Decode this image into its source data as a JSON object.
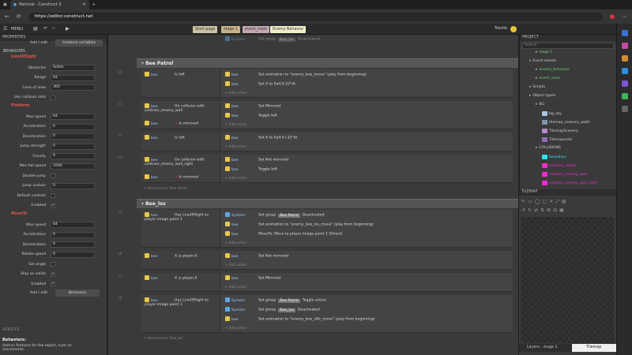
{
  "browser": {
    "tab_title": "Percival - Construct 3",
    "url": "https://editor.construct.net"
  },
  "app": {
    "menu_label": "MENU",
    "layout_tabs": [
      {
        "label": "Start page",
        "color": "#c9c3a4"
      },
      {
        "label": "stage 1",
        "color": "#c9b289"
      },
      {
        "label": "event_main",
        "color": "#c2a7b3"
      },
      {
        "label": "Enemy Behavior",
        "color": "#f2f0c8"
      }
    ],
    "user": "Twistie"
  },
  "properties": {
    "header": "PROPERTIES",
    "add_edit": "Add / edit",
    "instance_variables_btn": "Instance variables",
    "behaviors_header": "BEHAVIORS",
    "los_name": "LineOfSight",
    "los_rows": [
      {
        "label": "Obstacles",
        "value": "Solids"
      },
      {
        "label": "Range",
        "value": "64"
      },
      {
        "label": "Cone of view",
        "value": "360"
      },
      {
        "label": "Use collision cells",
        "value": ""
      }
    ],
    "platform_name": "Platform",
    "platform_rows": [
      {
        "label": "Max speed",
        "value": "64"
      },
      {
        "label": "Acceleration",
        "value": "0"
      },
      {
        "label": "Deceleration",
        "value": "0"
      },
      {
        "label": "Jump strength",
        "value": "0"
      },
      {
        "label": "Gravity",
        "value": "0"
      },
      {
        "label": "Max fall speed",
        "value": "1000"
      },
      {
        "label": "Double-jump",
        "value": ""
      },
      {
        "label": "Jump sustain",
        "value": "0"
      },
      {
        "label": "Default controls",
        "value": ""
      },
      {
        "label": "Enabled",
        "value": "✓"
      }
    ],
    "moveto_name": "MoveTo",
    "moveto_rows": [
      {
        "label": "Max speed",
        "value": "64"
      },
      {
        "label": "Acceleration",
        "value": "0"
      },
      {
        "label": "Deceleration",
        "value": "0"
      },
      {
        "label": "Rotate speed",
        "value": "0"
      },
      {
        "label": "Set angle",
        "value": ""
      },
      {
        "label": "Stop on solids",
        "value": "✓"
      },
      {
        "label": "Enabled",
        "value": "✓"
      }
    ],
    "behaviors_btn": "Behaviors",
    "effects_header": "EFFECTS",
    "help_title": "Behaviors:",
    "help_text": "Add-on features for the object, such as movements."
  },
  "events": {
    "top_rows": [
      {
        "obj": "System",
        "text": "Set group",
        "tag": "Bee_los",
        "text2": "Deactivated"
      }
    ],
    "group1": "Bee Patrol",
    "group1_events": [
      {
        "num": "10",
        "cond_obj": "bee",
        "cond": "Is left",
        "actions": [
          {
            "obj": "bee",
            "text": "Set animation to \"enemy_bee_move\" (play from beginning)"
          },
          {
            "obj": "bee",
            "text": "Set X to Self.X-32*dt"
          }
        ]
      },
      {
        "num": "11",
        "cond_obj": "bee",
        "cond": "On collision with collision_enemy_wall",
        "cond2": "Is mirrored",
        "actions": [
          {
            "obj": "bee",
            "text": "Set Mirrored"
          },
          {
            "obj": "bee",
            "text": "Toggle left"
          }
        ]
      },
      {
        "num": "12",
        "cond_obj": "bee",
        "cond": "Is left",
        "actions": [
          {
            "obj": "bee",
            "text": "Set X to Self.X+32*dt"
          }
        ]
      },
      {
        "num": "13",
        "cond_obj": "bee",
        "cond": "On collision with collision_enemy_wall_right",
        "cond2": "Is mirrored",
        "actions": [
          {
            "obj": "bee",
            "text": "Set Not mirrored"
          },
          {
            "obj": "bee",
            "text": "Toggle left"
          }
        ]
      }
    ],
    "add_action": "Add action",
    "add_event_patrol": "Add event to 'Bee Patrol'",
    "group2": "Bee_los",
    "group2_events": [
      {
        "num": "15",
        "cond_obj": "bee",
        "cond": "Has LineOfSight to player image point 1",
        "actions": [
          {
            "obj": "System",
            "text": "Set group",
            "tag": "Bee Patrol",
            "text2": "Deactivated"
          },
          {
            "obj": "bee",
            "text": "Set animation to \"enemy_bee_los_move\" (play from beginning)"
          },
          {
            "obj": "bee",
            "text": "MoveTo: Move to player image point 1 (Direct)"
          }
        ]
      },
      {
        "num": "16",
        "cond_obj": "bee",
        "cond": "X ≤ player.X",
        "actions": [
          {
            "obj": "bee",
            "text": "Set Not mirrored"
          }
        ]
      },
      {
        "num": "17",
        "cond_obj": "bee",
        "cond": "X ≤ player.X",
        "actions": [
          {
            "obj": "bee",
            "text": "Set Mirrored"
          }
        ]
      },
      {
        "num": "18",
        "cond_obj": "bee",
        "cond": "Has LineOfSight to player image point 1",
        "actions": [
          {
            "obj": "System",
            "text": "Set group",
            "tag": "Bee Patrol",
            "text2": "Toggle active"
          },
          {
            "obj": "System",
            "text": "Set group",
            "tag": "Bee_los",
            "text2": "Deactivated"
          },
          {
            "obj": "bee",
            "text": "Set animation to \"enemy_bee_idle_move\" (play from beginning)"
          }
        ]
      }
    ],
    "add_event_los": "Add event to 'Bee_los'"
  },
  "project": {
    "header": "PROJECT",
    "search_placeholder": "Search",
    "items": [
      {
        "label": "stage 1",
        "color": "#6fd36f",
        "indent": 2
      },
      {
        "label": "Event sheets",
        "color": "#cfcfcf",
        "indent": 1
      },
      {
        "label": "enemy_behavior",
        "color": "#6fd36f",
        "indent": 2
      },
      {
        "label": "event_main",
        "color": "#6fd36f",
        "indent": 2
      },
      {
        "label": "Scripts",
        "color": "#cfcfcf",
        "indent": 1
      },
      {
        "label": "Object types",
        "color": "#cfcfcf",
        "indent": 1
      },
      {
        "label": "BG",
        "color": "#cfcfcf",
        "indent": 2
      },
      {
        "label": "bg_sky",
        "color": "#cfcfcf",
        "indent": 3,
        "swatch": "#a9c6e0"
      },
      {
        "label": "tilemap_scenery_walls",
        "color": "#cfcfcf",
        "indent": 3,
        "swatch": "#7f93b3"
      },
      {
        "label": "TilemapScenery",
        "color": "#cfcfcf",
        "indent": 3,
        "swatch": "#b58cc7"
      },
      {
        "label": "Tilemapsolid",
        "color": "#cfcfcf",
        "indent": 3,
        "swatch": "#8e6fb5"
      },
      {
        "label": "COLLISIONS",
        "color": "#cfcfcf",
        "indent": 2
      },
      {
        "label": "boundary",
        "color": "#27e4ef",
        "indent": 3,
        "swatch": "#27e4ef"
      },
      {
        "label": "collision_death",
        "color": "#f12ad0",
        "indent": 3,
        "swatch": "#f12ad0"
      },
      {
        "label": "collision_enemy_wall",
        "color": "#f12ad0",
        "indent": 3,
        "swatch": "#f12ad0"
      },
      {
        "label": "collision_enemy_wall_right",
        "color": "#f12ad0",
        "indent": 3,
        "swatch": "#f12ad0"
      }
    ],
    "tilemap_header": "TILEMAP",
    "bottom_tabs": [
      "Layers - stage 1",
      "Tilemap"
    ]
  }
}
